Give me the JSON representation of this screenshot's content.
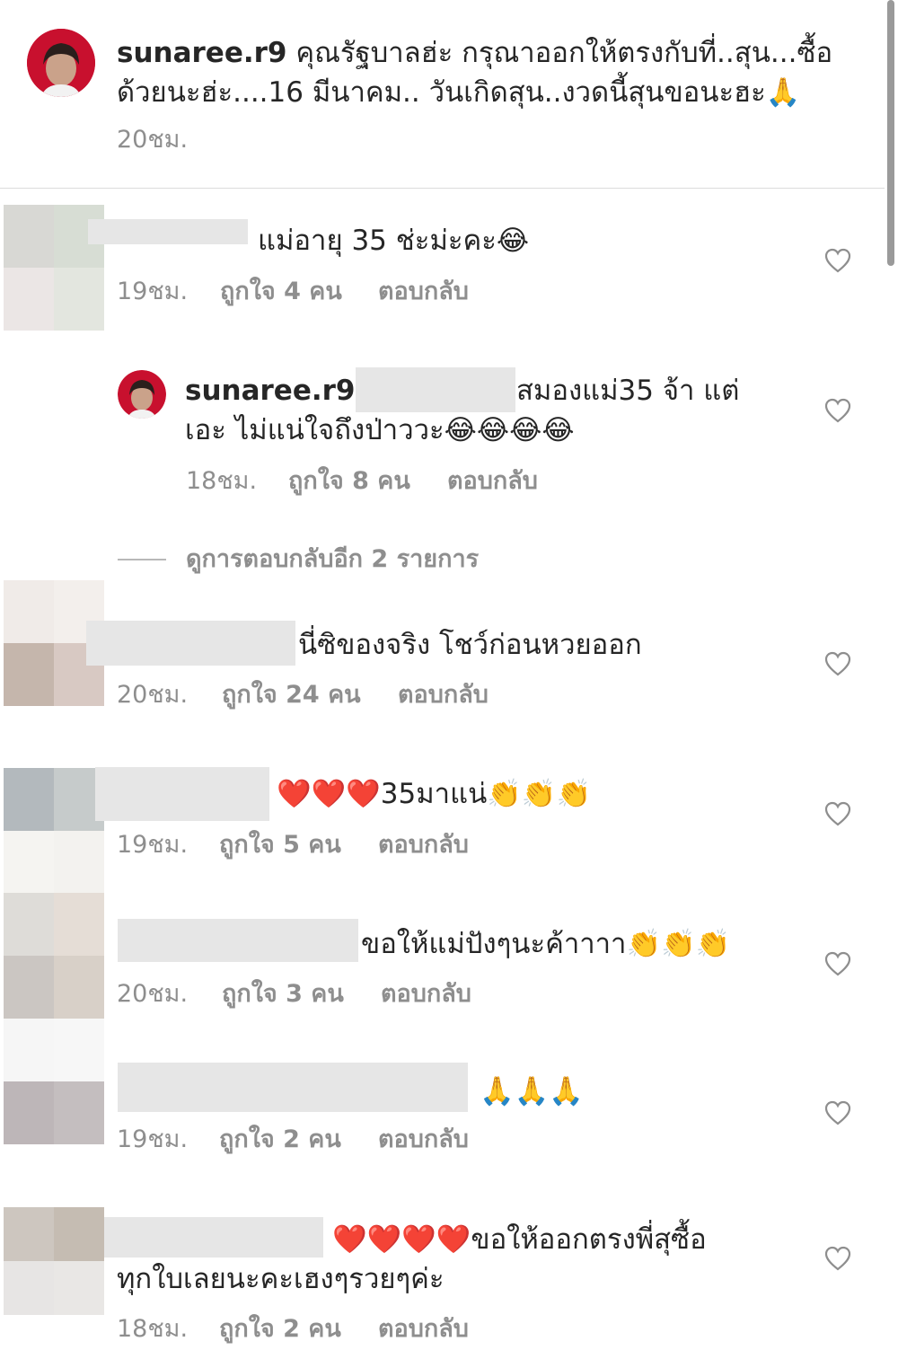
{
  "caption": {
    "username": "sunaree.r9",
    "text_line1": " คุณรัฐบาลฮ่ะ กรุณาออกให้ตรงกับที่..สุน...ซื้อ",
    "text_line2": "ด้วยนะฮ่ะ....16 มีนาคม.. วันเกิดสุน..งวดนี้สุนขอนะฮะ🙏",
    "time": "20ชม."
  },
  "comments": [
    {
      "text": "แม่อายุ 35 ช่ะม่ะคะ😂",
      "time": "19ชม.",
      "likes": "ถูกใจ 4 คน",
      "reply": "ตอบกลับ"
    },
    {
      "username": "sunaree.r9",
      "text_line1": "สมองแม่35 จ้า แต่",
      "text_line2": "เอะ ไม่แน่ใจถึงป่าววะ😂😂😂😂",
      "time": "18ชม.",
      "likes": "ถูกใจ 8 คน",
      "reply": "ตอบกลับ"
    },
    {
      "text": "นี่ซิของจริง โชว์ก่อนหวยออก",
      "time": "20ชม.",
      "likes": "ถูกใจ 24 คน",
      "reply": "ตอบกลับ"
    },
    {
      "text": "❤️❤️❤️35มาแน่👏👏👏",
      "time": "19ชม.",
      "likes": "ถูกใจ 5 คน",
      "reply": "ตอบกลับ"
    },
    {
      "text": "ขอให้แม่ปังๆนะค้าาาา👏👏👏",
      "time": "20ชม.",
      "likes": "ถูกใจ 3 คน",
      "reply": "ตอบกลับ"
    },
    {
      "text": "🙏🙏🙏",
      "time": "19ชม.",
      "likes": "ถูกใจ 2 คน",
      "reply": "ตอบกลับ"
    },
    {
      "text_line1": "❤️❤️❤️❤️ขอให้ออกตรงพี่สุซื้อ",
      "text_line2": "ทุกใบเลยนะคะเฮงๆรวยๆค่ะ",
      "time": "18ชม.",
      "likes": "ถูกใจ 2 คน",
      "reply": "ตอบกลับ"
    }
  ],
  "view_replies": "ดูการตอบกลับอีก 2 รายการ",
  "colors": {
    "text": "#262626",
    "meta": "#8e8e8e",
    "divider": "#dbdbdb",
    "avatar_red": "#c8102e"
  },
  "icons": {
    "heart": "heart-outline-icon"
  }
}
